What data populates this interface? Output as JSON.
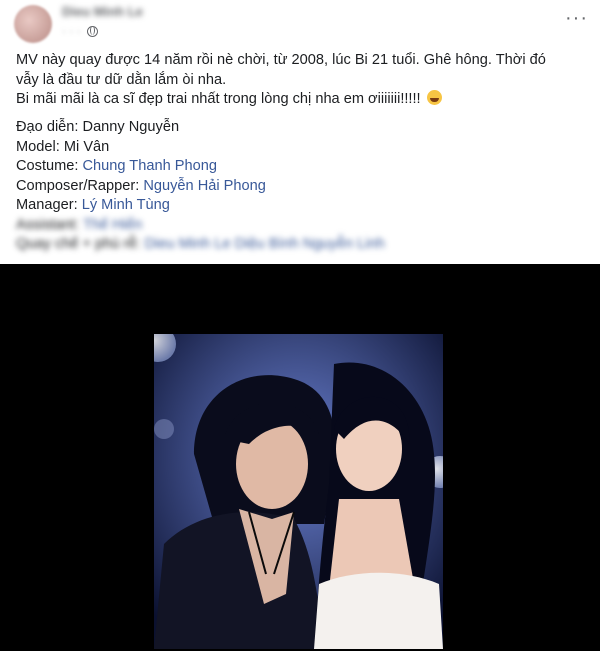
{
  "post": {
    "author": "Dieu Minh Le",
    "meta_dots": "· · ·",
    "body_line1": "MV này quay được 14 năm rồi nè chời, từ 2008, lúc Bi 21 tuổi. Ghê hông. Thời đó",
    "body_line2": "vẫy là đầu tư dữ dằn lắm òi nha.",
    "body_line3": "Bi mãi mãi là ca sĩ đẹp trai nhất trong lòng chị nha em ơiiiiiii!!!!!",
    "credits": [
      {
        "label": "Đạo diễn: ",
        "value": "Danny Nguyễn",
        "link": false
      },
      {
        "label": "Model: ",
        "value": "Mi Vân",
        "link": false
      },
      {
        "label": "Costume: ",
        "value": "Chung Thanh Phong",
        "link": true
      },
      {
        "label": "Composer/Rapper: ",
        "value": "Nguyễn Hải Phong",
        "link": true
      },
      {
        "label": "Manager: ",
        "value": "Lý Minh Tùng",
        "link": true
      }
    ],
    "blurred_line1_label": "Assistant: ",
    "blurred_line1_value": "Thế Hiển",
    "blurred_line2_label": "Quay chế + phù rễ: ",
    "blurred_line2_value": "Dieu Minh Le Diệu Bình Nguyễn Linh"
  },
  "icons": {
    "globe": "globe-icon",
    "more": "more-icon",
    "emoji": "laughing-emoji-icon"
  },
  "more_symbol": "···",
  "colors": {
    "link": "#385898",
    "video_background": "#000000"
  }
}
